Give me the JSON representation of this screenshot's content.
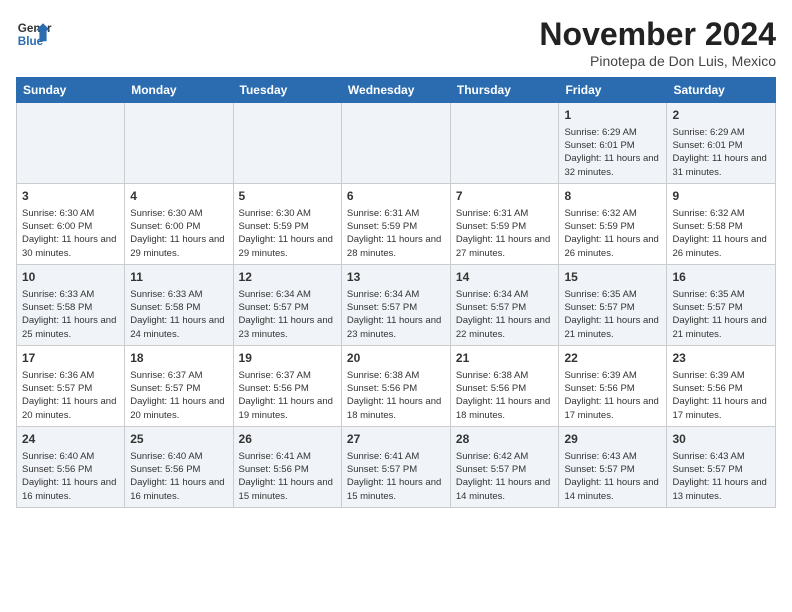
{
  "logo": {
    "line1": "General",
    "line2": "Blue"
  },
  "title": "November 2024",
  "subtitle": "Pinotepa de Don Luis, Mexico",
  "weekdays": [
    "Sunday",
    "Monday",
    "Tuesday",
    "Wednesday",
    "Thursday",
    "Friday",
    "Saturday"
  ],
  "weeks": [
    [
      {
        "day": "",
        "info": ""
      },
      {
        "day": "",
        "info": ""
      },
      {
        "day": "",
        "info": ""
      },
      {
        "day": "",
        "info": ""
      },
      {
        "day": "",
        "info": ""
      },
      {
        "day": "1",
        "info": "Sunrise: 6:29 AM\nSunset: 6:01 PM\nDaylight: 11 hours and 32 minutes."
      },
      {
        "day": "2",
        "info": "Sunrise: 6:29 AM\nSunset: 6:01 PM\nDaylight: 11 hours and 31 minutes."
      }
    ],
    [
      {
        "day": "3",
        "info": "Sunrise: 6:30 AM\nSunset: 6:00 PM\nDaylight: 11 hours and 30 minutes."
      },
      {
        "day": "4",
        "info": "Sunrise: 6:30 AM\nSunset: 6:00 PM\nDaylight: 11 hours and 29 minutes."
      },
      {
        "day": "5",
        "info": "Sunrise: 6:30 AM\nSunset: 5:59 PM\nDaylight: 11 hours and 29 minutes."
      },
      {
        "day": "6",
        "info": "Sunrise: 6:31 AM\nSunset: 5:59 PM\nDaylight: 11 hours and 28 minutes."
      },
      {
        "day": "7",
        "info": "Sunrise: 6:31 AM\nSunset: 5:59 PM\nDaylight: 11 hours and 27 minutes."
      },
      {
        "day": "8",
        "info": "Sunrise: 6:32 AM\nSunset: 5:59 PM\nDaylight: 11 hours and 26 minutes."
      },
      {
        "day": "9",
        "info": "Sunrise: 6:32 AM\nSunset: 5:58 PM\nDaylight: 11 hours and 26 minutes."
      }
    ],
    [
      {
        "day": "10",
        "info": "Sunrise: 6:33 AM\nSunset: 5:58 PM\nDaylight: 11 hours and 25 minutes."
      },
      {
        "day": "11",
        "info": "Sunrise: 6:33 AM\nSunset: 5:58 PM\nDaylight: 11 hours and 24 minutes."
      },
      {
        "day": "12",
        "info": "Sunrise: 6:34 AM\nSunset: 5:57 PM\nDaylight: 11 hours and 23 minutes."
      },
      {
        "day": "13",
        "info": "Sunrise: 6:34 AM\nSunset: 5:57 PM\nDaylight: 11 hours and 23 minutes."
      },
      {
        "day": "14",
        "info": "Sunrise: 6:34 AM\nSunset: 5:57 PM\nDaylight: 11 hours and 22 minutes."
      },
      {
        "day": "15",
        "info": "Sunrise: 6:35 AM\nSunset: 5:57 PM\nDaylight: 11 hours and 21 minutes."
      },
      {
        "day": "16",
        "info": "Sunrise: 6:35 AM\nSunset: 5:57 PM\nDaylight: 11 hours and 21 minutes."
      }
    ],
    [
      {
        "day": "17",
        "info": "Sunrise: 6:36 AM\nSunset: 5:57 PM\nDaylight: 11 hours and 20 minutes."
      },
      {
        "day": "18",
        "info": "Sunrise: 6:37 AM\nSunset: 5:57 PM\nDaylight: 11 hours and 20 minutes."
      },
      {
        "day": "19",
        "info": "Sunrise: 6:37 AM\nSunset: 5:56 PM\nDaylight: 11 hours and 19 minutes."
      },
      {
        "day": "20",
        "info": "Sunrise: 6:38 AM\nSunset: 5:56 PM\nDaylight: 11 hours and 18 minutes."
      },
      {
        "day": "21",
        "info": "Sunrise: 6:38 AM\nSunset: 5:56 PM\nDaylight: 11 hours and 18 minutes."
      },
      {
        "day": "22",
        "info": "Sunrise: 6:39 AM\nSunset: 5:56 PM\nDaylight: 11 hours and 17 minutes."
      },
      {
        "day": "23",
        "info": "Sunrise: 6:39 AM\nSunset: 5:56 PM\nDaylight: 11 hours and 17 minutes."
      }
    ],
    [
      {
        "day": "24",
        "info": "Sunrise: 6:40 AM\nSunset: 5:56 PM\nDaylight: 11 hours and 16 minutes."
      },
      {
        "day": "25",
        "info": "Sunrise: 6:40 AM\nSunset: 5:56 PM\nDaylight: 11 hours and 16 minutes."
      },
      {
        "day": "26",
        "info": "Sunrise: 6:41 AM\nSunset: 5:56 PM\nDaylight: 11 hours and 15 minutes."
      },
      {
        "day": "27",
        "info": "Sunrise: 6:41 AM\nSunset: 5:57 PM\nDaylight: 11 hours and 15 minutes."
      },
      {
        "day": "28",
        "info": "Sunrise: 6:42 AM\nSunset: 5:57 PM\nDaylight: 11 hours and 14 minutes."
      },
      {
        "day": "29",
        "info": "Sunrise: 6:43 AM\nSunset: 5:57 PM\nDaylight: 11 hours and 14 minutes."
      },
      {
        "day": "30",
        "info": "Sunrise: 6:43 AM\nSunset: 5:57 PM\nDaylight: 11 hours and 13 minutes."
      }
    ]
  ]
}
